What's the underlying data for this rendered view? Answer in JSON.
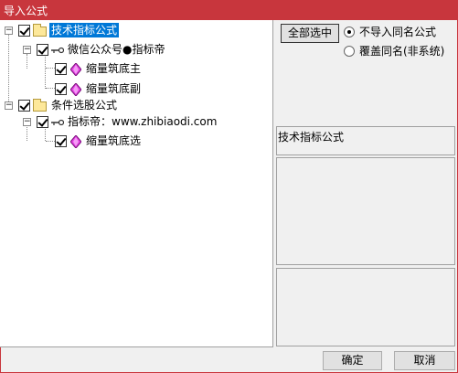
{
  "window": {
    "title": "导入公式"
  },
  "tree": {
    "nodes": [
      {
        "label": "技术指标公式",
        "checked": true,
        "icon": "folder-icon",
        "expander": "minus"
      },
      {
        "label": "微信公众号●指标帝",
        "checked": true,
        "icon": "key-icon",
        "expander": "minus"
      },
      {
        "label": "缩量筑底主",
        "checked": true,
        "icon": "gem-icon"
      },
      {
        "label": "缩量筑底副",
        "checked": true,
        "icon": "gem-icon"
      },
      {
        "label": "条件选股公式",
        "checked": true,
        "icon": "folder-icon",
        "expander": "minus"
      },
      {
        "label": "指标帝：www.zhibiaodi.com",
        "checked": true,
        "icon": "key-icon",
        "expander": "minus"
      },
      {
        "label": "缩量筑底选",
        "checked": true,
        "icon": "gem-icon"
      }
    ]
  },
  "controls": {
    "select_all": "全部选中",
    "radio_no_import": "不导入同名公式",
    "radio_overwrite": "覆盖同名(非系统)",
    "selected_option": "不导入同名公式"
  },
  "info": {
    "category": "技术指标公式"
  },
  "buttons": {
    "ok": "确定",
    "cancel": "取消"
  },
  "colors": {
    "titlebar": "#c8363d",
    "selection": "#0078d7"
  }
}
